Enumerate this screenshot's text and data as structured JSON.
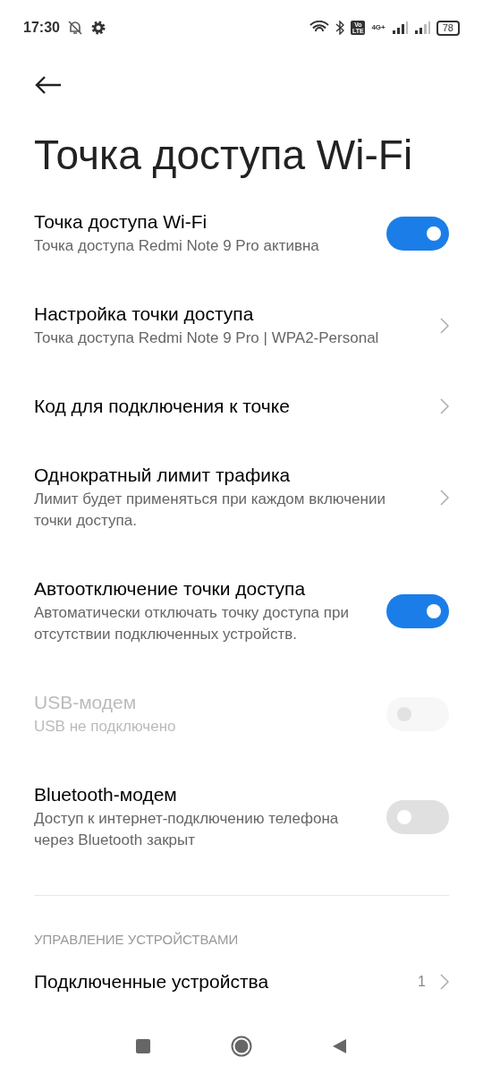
{
  "status_bar": {
    "time": "17:30",
    "network": "4G+",
    "volte": "Vo LTE",
    "battery": "78"
  },
  "title": "Точка доступа Wi-Fi",
  "items": [
    {
      "kind": "toggle",
      "title": "Точка доступа Wi-Fi",
      "subtitle": "Точка доступа Redmi Note 9 Pro активна",
      "on": true,
      "disabled": false
    },
    {
      "kind": "link",
      "title": "Настройка точки доступа",
      "subtitle": "Точка доступа Redmi Note 9 Pro | WPA2-Personal"
    },
    {
      "kind": "link",
      "title": "Код для подключения к точке"
    },
    {
      "kind": "link",
      "title": "Однократный лимит трафика",
      "subtitle": "Лимит будет применяться при каждом включении точки доступа."
    },
    {
      "kind": "toggle",
      "title": "Автоотключение точки доступа",
      "subtitle": "Автоматически отключать точку доступа при отсутствии подключенных устройств.",
      "on": true,
      "disabled": false
    },
    {
      "kind": "toggle",
      "title": "USB-модем",
      "subtitle": "USB не подключено",
      "on": false,
      "disabled": true
    },
    {
      "kind": "toggle",
      "title": "Bluetooth-модем",
      "subtitle": "Доступ к интернет-подключению телефона через Bluetooth закрыт",
      "on": false,
      "disabled": false
    }
  ],
  "section": {
    "header": "УПРАВЛЕНИЕ УСТРОЙСТВАМИ",
    "items": [
      {
        "kind": "link",
        "title": "Подключенные устройства",
        "value": "1"
      }
    ]
  }
}
